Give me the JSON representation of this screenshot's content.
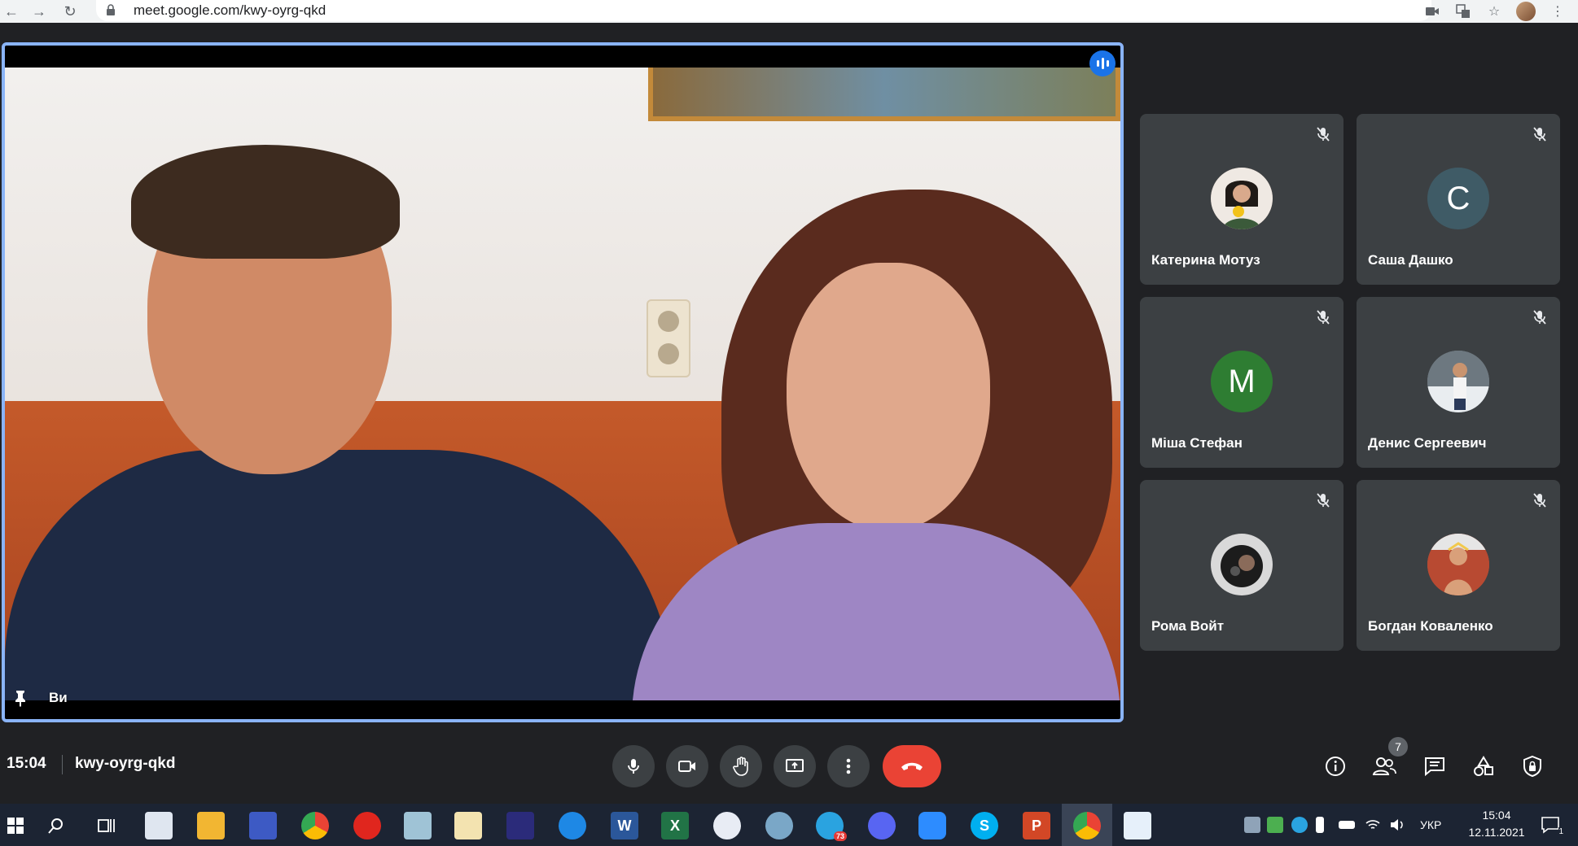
{
  "browser": {
    "url": "meet.google.com/kwy-oyrg-qkd"
  },
  "main_tile": {
    "label": "Ви"
  },
  "participants": [
    {
      "name": "Катерина Мотуз",
      "initial": "",
      "avatar_color": "#6b4a3a"
    },
    {
      "name": "Саша Дашко",
      "initial": "C",
      "avatar_color": "#3f5b66"
    },
    {
      "name": "Міша Стефан",
      "initial": "M",
      "avatar_color": "#2e7d32"
    },
    {
      "name": "Денис Сергеевич",
      "initial": "",
      "avatar_color": "#7f8890"
    },
    {
      "name": "Рома Войт",
      "initial": "",
      "avatar_color": "#2b2b2b"
    },
    {
      "name": "Богдан Коваленко",
      "initial": "",
      "avatar_color": "#c0533a"
    }
  ],
  "bottom_bar": {
    "time": "15:04",
    "meeting_code": "kwy-oyrg-qkd",
    "people_count": "7"
  },
  "taskbar": {
    "language": "УКР",
    "time": "15:04",
    "date": "12.11.2021",
    "notification_count": "1",
    "telegram_badge": "73"
  },
  "colors": {
    "accent": "#8ab4f8",
    "hangup": "#ea4335",
    "tile_bg": "#3c4043",
    "page_bg": "#202124"
  }
}
